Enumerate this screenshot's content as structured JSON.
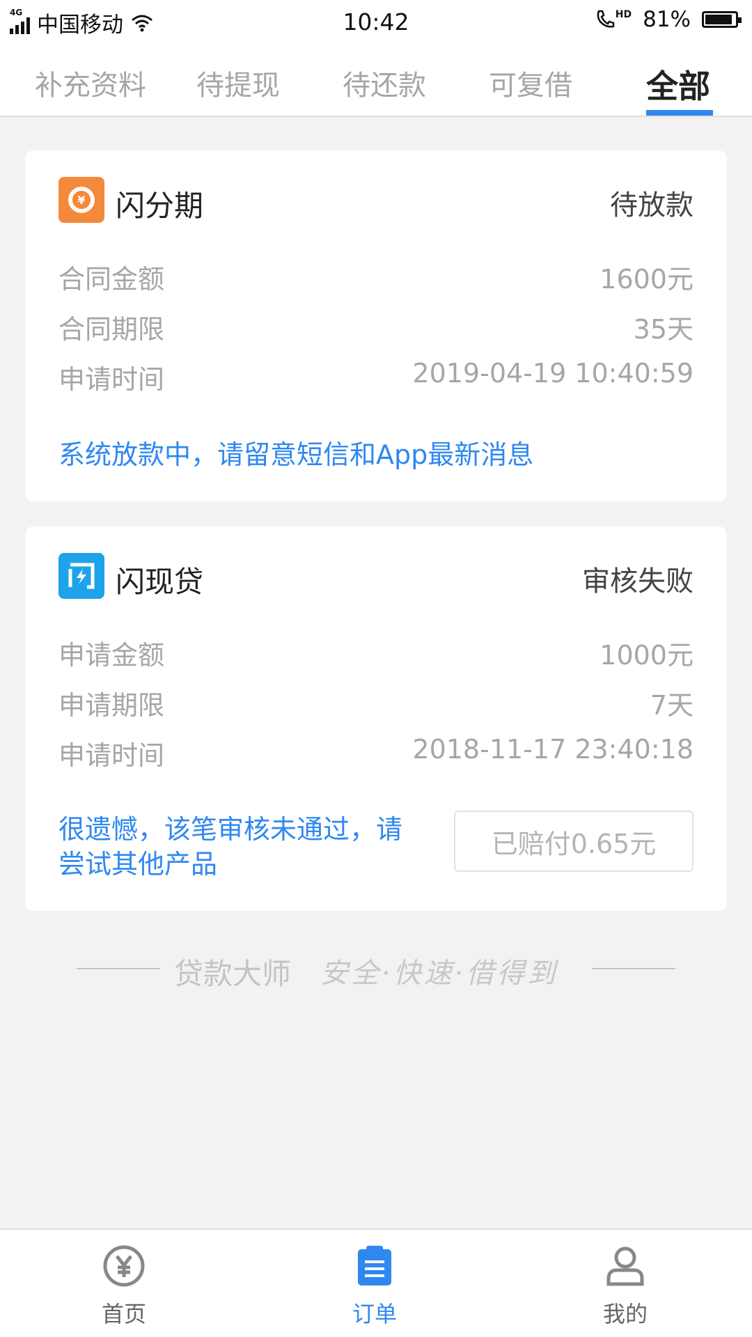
{
  "status_bar": {
    "network_tag": "4G",
    "carrier": "中国移动",
    "time": "10:42",
    "call_badge": "HD",
    "battery_percent": "81%"
  },
  "tabs": [
    {
      "label": "补充资料",
      "active": false
    },
    {
      "label": "待提现",
      "active": false
    },
    {
      "label": "待还款",
      "active": false
    },
    {
      "label": "可复借",
      "active": false
    },
    {
      "label": "全部",
      "active": true
    }
  ],
  "cards": [
    {
      "product": "闪分期",
      "logo_icon": "yuan-coin-logo",
      "status": "待放款",
      "rows": [
        {
          "label": "合同金额",
          "value": "1600元"
        },
        {
          "label": "合同期限",
          "value": "35天"
        },
        {
          "label": "申请时间",
          "value": "2019-04-19 10:40:59"
        }
      ],
      "message": "系统放款中，请留意短信和App最新消息"
    },
    {
      "product": "闪现贷",
      "logo_icon": "lightning-door-logo",
      "status": "审核失败",
      "rows": [
        {
          "label": "申请金额",
          "value": "1000元"
        },
        {
          "label": "申请期限",
          "value": "7天"
        },
        {
          "label": "申请时间",
          "value": "2018-11-17 23:40:18"
        }
      ],
      "message": "很遗憾，该笔审核未通过，请尝试其他产品",
      "message_line1": "很遗憾，该笔审核未通过，请",
      "message_line2": "尝试其他产品",
      "compensation_label": "已赔付0.65元"
    }
  ],
  "slogan": {
    "brand": "贷款大师",
    "tagline": "安全·快速·借得到"
  },
  "bottom_nav": [
    {
      "label": "首页",
      "icon": "yuan-circle-icon",
      "active": false
    },
    {
      "label": "订单",
      "icon": "clipboard-list-icon",
      "active": true
    },
    {
      "label": "我的",
      "icon": "person-icon",
      "active": false
    }
  ],
  "colors": {
    "accent": "#2f88f0",
    "orange_logo": "#f3893b",
    "blue_logo": "#1ea3ea",
    "background": "#f2f2f2"
  }
}
